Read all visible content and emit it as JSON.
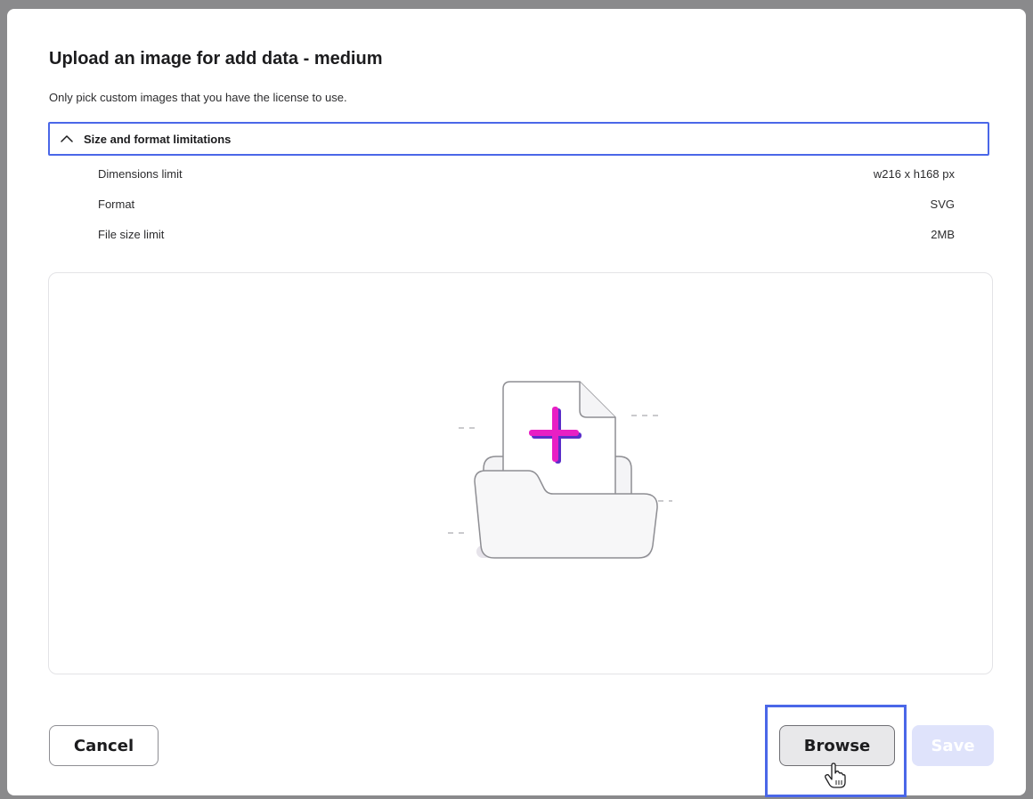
{
  "dialog": {
    "title": "Upload an image for add data - medium",
    "subtitle": "Only pick custom images that you have the license to use."
  },
  "limitations": {
    "header": "Size and format limitations",
    "expanded": true,
    "rows": [
      {
        "label": "Dimensions limit",
        "value": "w216 x h168 px"
      },
      {
        "label": "Format",
        "value": "SVG"
      },
      {
        "label": "File size limit",
        "value": "2MB"
      }
    ]
  },
  "dropzone": {
    "illustration": "folder-with-add-file-icon",
    "accent_color": "#e81fc4"
  },
  "footer": {
    "cancel_label": "Cancel",
    "browse_label": "Browse",
    "save_label": "Save",
    "focus_color": "#4a67e8",
    "save_disabled": true
  }
}
